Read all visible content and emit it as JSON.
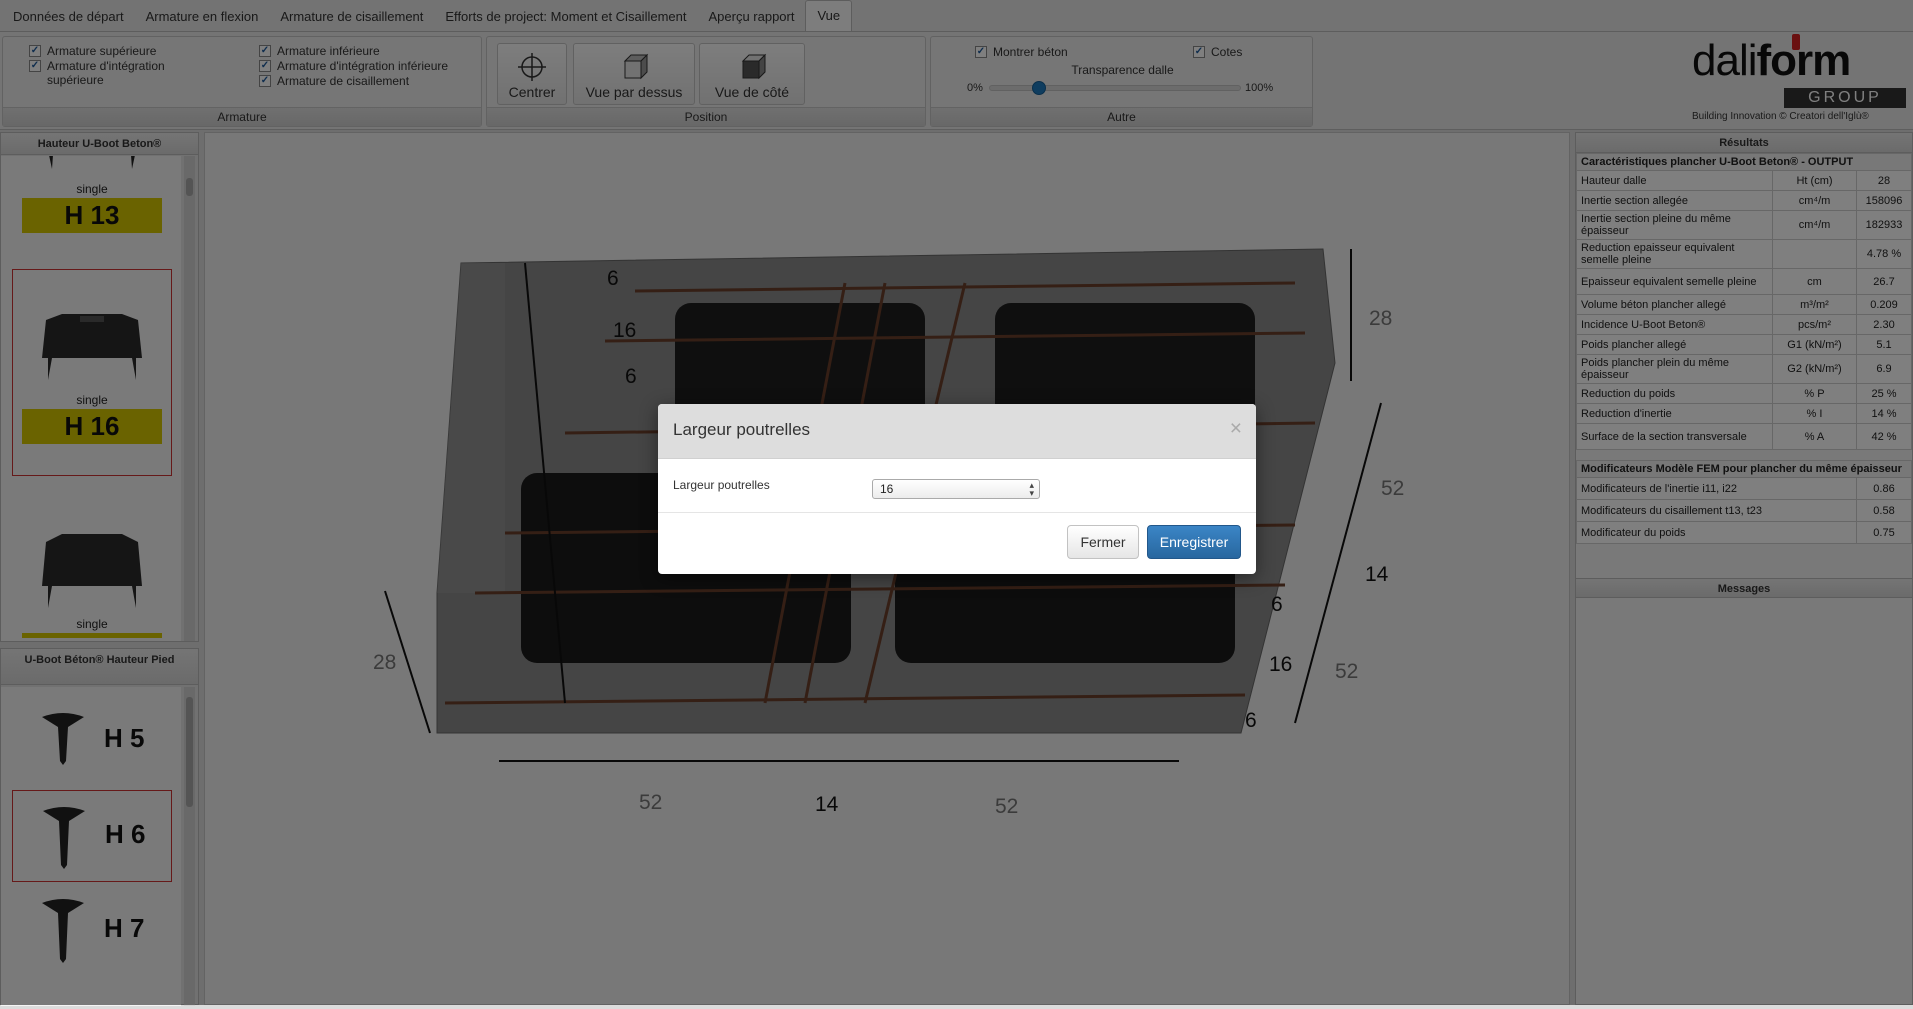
{
  "tabs": [
    {
      "label": "Données de départ"
    },
    {
      "label": "Armature en flexion"
    },
    {
      "label": "Armature de cisaillement"
    },
    {
      "label": "Efforts de project: Moment et Cisaillement"
    },
    {
      "label": "Aperçu rapport"
    },
    {
      "label": "Vue",
      "active": true
    }
  ],
  "toolbar": {
    "armature": {
      "label": "Armature",
      "checks": [
        {
          "label": "Armature supérieure"
        },
        {
          "label": "Armature d'intégration supérieure"
        },
        {
          "label": "Armature inférieure"
        },
        {
          "label": "Armature d'intégration inférieure"
        },
        {
          "label": "Armature de cisaillement"
        }
      ]
    },
    "position": {
      "label": "Position",
      "buttons": [
        {
          "label": "Centrer",
          "icon": "crosshair-icon"
        },
        {
          "label": "Vue par dessus",
          "icon": "cube-top-icon"
        },
        {
          "label": "Vue de côté",
          "icon": "cube-side-icon"
        }
      ]
    },
    "autre": {
      "label": "Autre",
      "show_concrete": "Montrer béton",
      "dimensions": "Cotes",
      "transparency": "Transparence dalle",
      "min": "0%",
      "max": "100%",
      "transparency_value": 0.2
    }
  },
  "logo": {
    "brand_a": "dali",
    "brand_b": "form",
    "group": "GROUP",
    "tagline": "Building Innovation © Creatori dell'Iglù®",
    "accent": "#d42121"
  },
  "left_top": {
    "title": "Hauteur U-Boot Beton®",
    "items": [
      {
        "caption": "single",
        "label": "H 13"
      },
      {
        "caption": "single",
        "label": "H 16",
        "selected": true
      },
      {
        "caption": "single",
        "label": ""
      }
    ]
  },
  "left_bottom": {
    "title": "U-Boot Béton® Hauteur Pied",
    "items": [
      {
        "label": "H 5"
      },
      {
        "label": "H 6",
        "selected": true
      },
      {
        "label": "H 7"
      }
    ]
  },
  "viewport": {
    "dims": [
      "6",
      "16",
      "6",
      "28",
      "52",
      "14",
      "6",
      "16",
      "52",
      "6",
      "28",
      "52",
      "14",
      "52"
    ]
  },
  "results": {
    "title": "Résultats",
    "section1": "Caractéristiques plancher U-Boot Beton® - OUTPUT",
    "rows": [
      {
        "label": "Hauteur dalle",
        "unit": "Ht (cm)",
        "value": "28"
      },
      {
        "label": "Inertie section allegée",
        "unit": "cm⁴/m",
        "value": "158096"
      },
      {
        "label": "Inertie section pleine du même épaisseur",
        "unit": "cm⁴/m",
        "value": "182933"
      },
      {
        "label": "Reduction epaisseur equivalent semelle pleine",
        "unit": "",
        "value": "4.78 %"
      },
      {
        "label": "Epaisseur equivalent semelle pleine",
        "unit": "cm",
        "value": "26.7"
      },
      {
        "label": "Volume béton plancher allegé",
        "unit": "m³/m²",
        "value": "0.209"
      },
      {
        "label": "Incidence U-Boot Beton®",
        "unit": "pcs/m²",
        "value": "2.30"
      },
      {
        "label": "Poids plancher allegé",
        "unit": "G1 (kN/m²)",
        "value": "5.1"
      },
      {
        "label": "Poids plancher plein du même épaisseur",
        "unit": "G2 (kN/m²)",
        "value": "6.9"
      },
      {
        "label": "Reduction du poids",
        "unit": "% P",
        "value": "25 %"
      },
      {
        "label": "Reduction d'inertie",
        "unit": "% I",
        "value": "14 %"
      },
      {
        "label": "Surface de la section transversale",
        "unit": "% A",
        "value": "42 %"
      }
    ],
    "section2": "Modificateurs Modèle FEM pour plancher du même épaisseur",
    "rows2": [
      {
        "label": "Modificateurs de l'inertie i11, i22",
        "value": "0.86"
      },
      {
        "label": "Modificateurs du cisaillement t13, t23",
        "value": "0.58"
      },
      {
        "label": "Modificateur du poids",
        "value": "0.75"
      }
    ],
    "messages": "Messages"
  },
  "modal": {
    "title": "Largeur poutrelles",
    "close": "×",
    "field_label": "Largeur poutrelles",
    "value": "16",
    "btn_close": "Fermer",
    "btn_save": "Enregistrer"
  }
}
